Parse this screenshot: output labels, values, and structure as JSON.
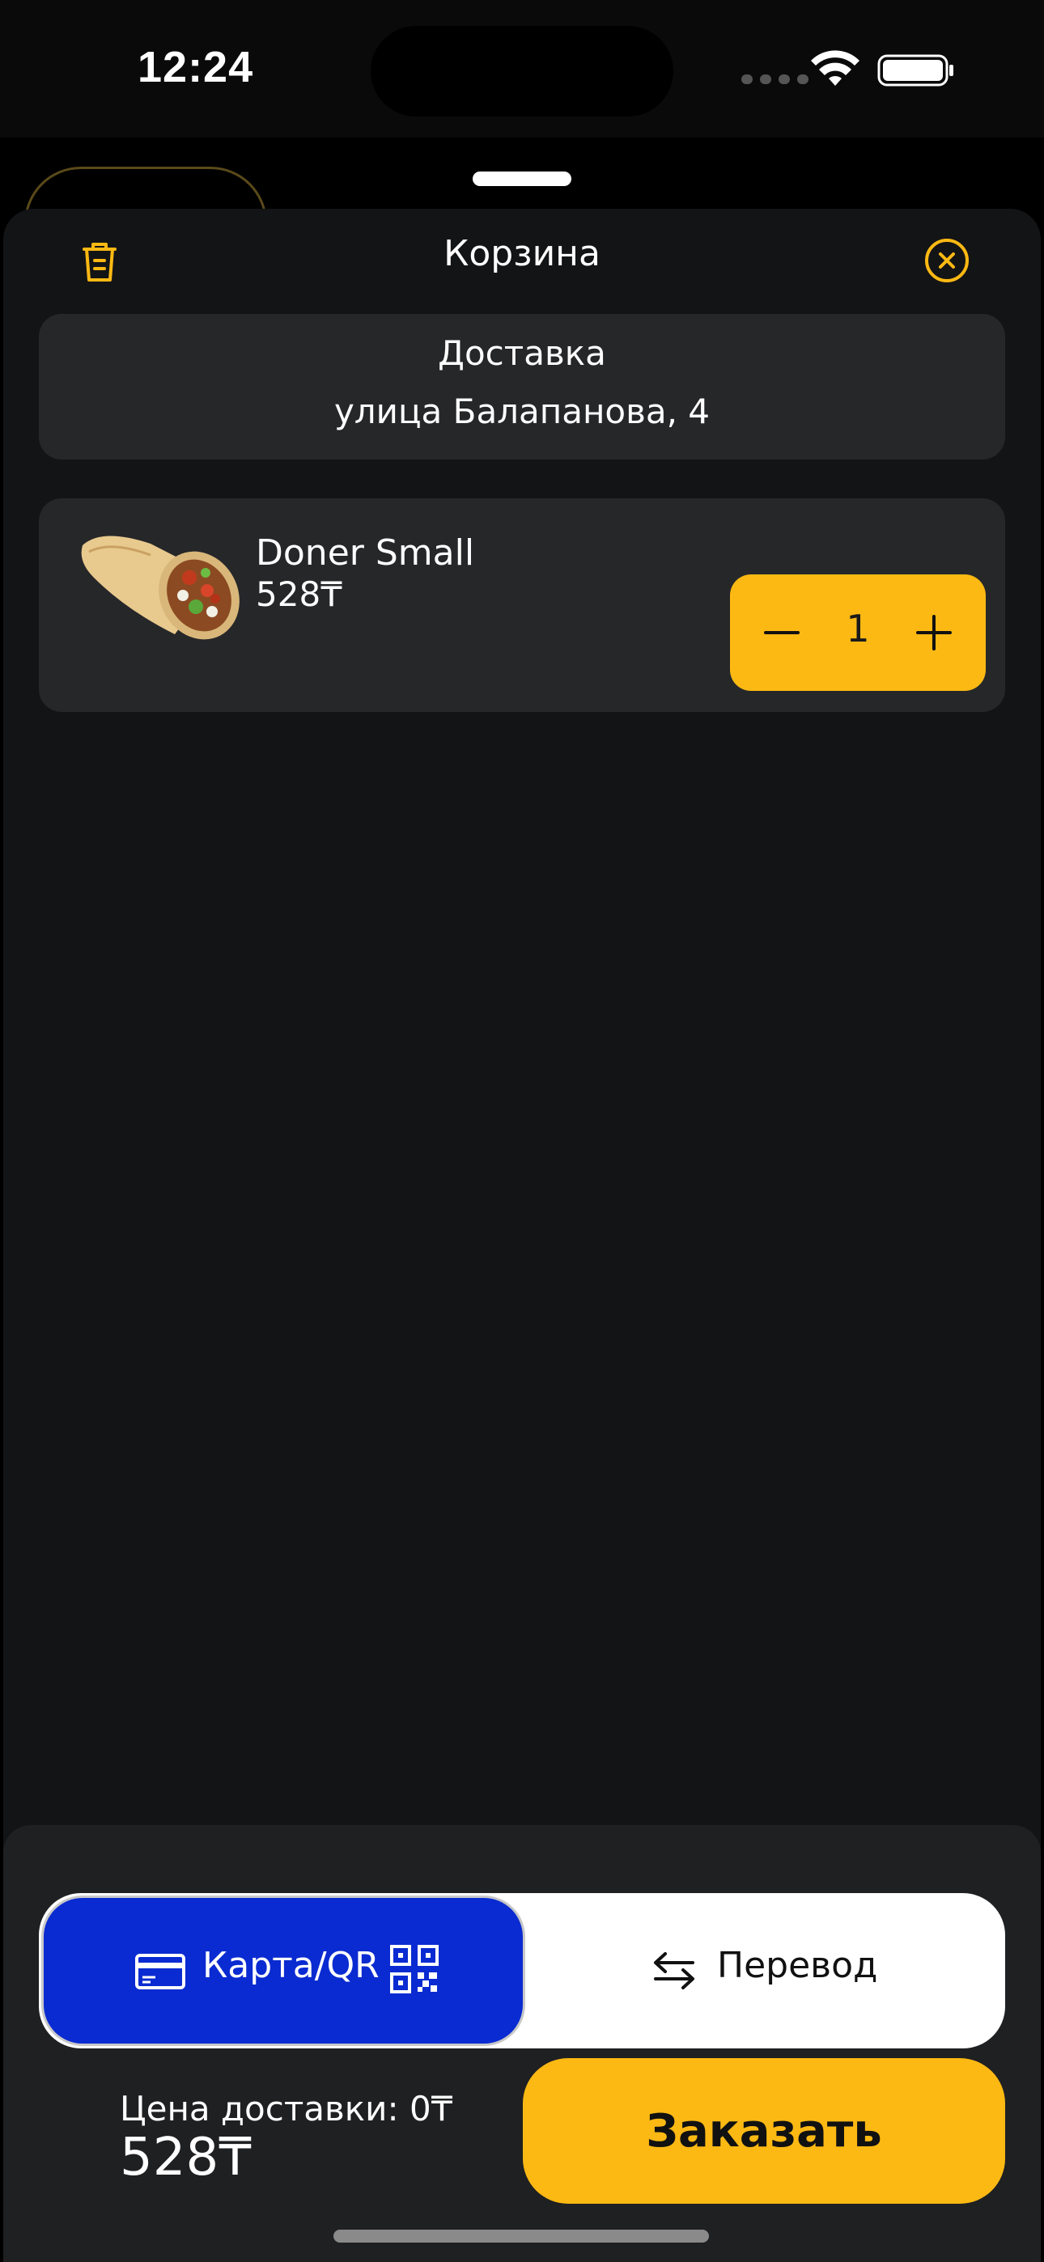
{
  "status_bar": {
    "time": "12:24"
  },
  "sheet": {
    "title": "Корзина",
    "icons": {
      "trash": "trash-icon",
      "close": "close-circle-icon"
    }
  },
  "delivery": {
    "title": "Доставка",
    "address": "улица Балапанова, 4"
  },
  "cart": {
    "items": [
      {
        "name": "Doner Small",
        "price": "528₸",
        "quantity": "1",
        "image": "doner-wrap-image"
      }
    ]
  },
  "payment": {
    "options": [
      {
        "label": "Карта/QR",
        "icon": "credit-card-icon",
        "extra_icon": "qr-code-icon",
        "selected": true
      },
      {
        "label": "Перевод",
        "icon": "swap-arrows-icon",
        "selected": false
      }
    ]
  },
  "summary": {
    "delivery_fee": "Цена доставки: 0₸",
    "total": "528₸"
  },
  "actions": {
    "order_label": "Заказать"
  },
  "colors": {
    "accent": "#fdb913",
    "selected_payment": "#0a2bd1",
    "card_bg": "#262729",
    "sheet_bg": "#131416"
  }
}
